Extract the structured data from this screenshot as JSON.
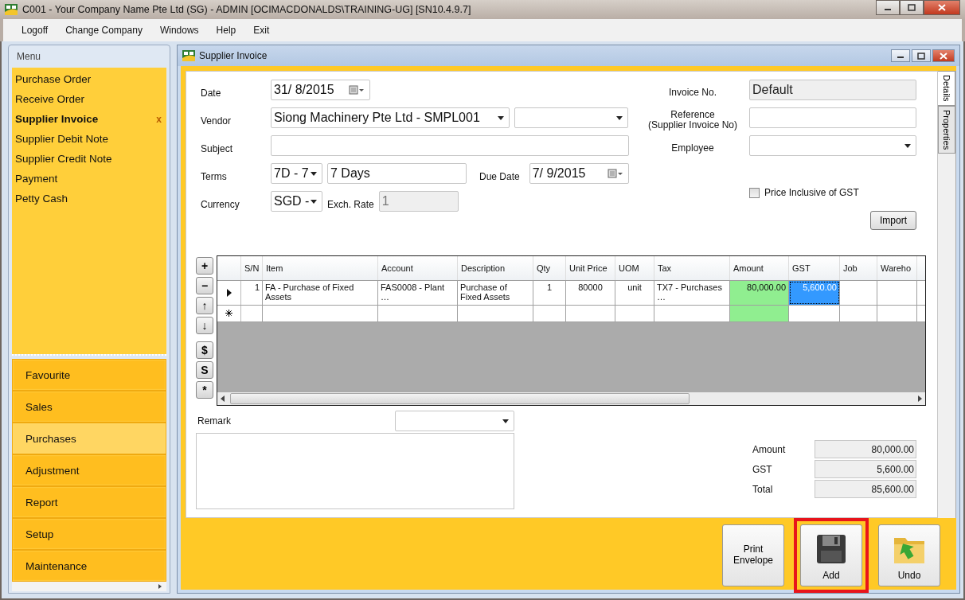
{
  "window": {
    "title": "C001 - Your Company Name Pte Ltd (SG) - ADMIN [OCIMACDONALDS\\TRAINING-UG] [SN10.4.9.7]"
  },
  "menu_bar": [
    "Logoff",
    "Change Company",
    "Windows",
    "Help",
    "Exit"
  ],
  "sidebar": {
    "header": "Menu",
    "items": [
      {
        "label": "Purchase Order",
        "selected": false
      },
      {
        "label": "Receive Order",
        "selected": false
      },
      {
        "label": "Supplier Invoice",
        "selected": true,
        "close": "x"
      },
      {
        "label": "Supplier Debit Note",
        "selected": false
      },
      {
        "label": "Supplier Credit Note",
        "selected": false
      },
      {
        "label": "Payment",
        "selected": false
      },
      {
        "label": "Petty Cash",
        "selected": false
      }
    ],
    "modules": [
      {
        "label": "Favourite",
        "selected": false
      },
      {
        "label": "Sales",
        "selected": false
      },
      {
        "label": "Purchases",
        "selected": true
      },
      {
        "label": "Adjustment",
        "selected": false
      },
      {
        "label": "Report",
        "selected": false
      },
      {
        "label": "Setup",
        "selected": false
      },
      {
        "label": "Maintenance",
        "selected": false
      }
    ]
  },
  "document": {
    "title": "Supplier Invoice",
    "side_tabs": [
      {
        "label": "Details",
        "selected": true
      },
      {
        "label": "Properties",
        "selected": false
      }
    ],
    "date": {
      "label": "Date",
      "value": "31/  8/2015"
    },
    "vendor": {
      "label": "Vendor",
      "value": "Siong Machinery Pte Ltd - SMPL001"
    },
    "subject": {
      "label": "Subject"
    },
    "terms": {
      "label": "Terms",
      "code": "7D - 7",
      "text": "7 Days"
    },
    "due_date": {
      "label": "Due Date",
      "value": "7/  9/2015"
    },
    "currency": {
      "label": "Currency",
      "value": "SGD -"
    },
    "exch_rate": {
      "label": "Exch. Rate",
      "value": "1",
      "disabled": true
    },
    "invoice_no": {
      "label": "Invoice No.",
      "value": "Default",
      "disabled": true
    },
    "reference": {
      "label": "Reference\n(Supplier Invoice No)"
    },
    "employee": {
      "label": "Employee"
    },
    "price_inclusive": {
      "label": "Price Inclusive of GST",
      "checked": false
    },
    "import_button": "Import",
    "grid_tools": [
      "+",
      "−",
      "↑",
      "↓",
      "$",
      "S",
      "*"
    ],
    "table": {
      "columns": [
        {
          "label": "S/N",
          "kind": "input"
        },
        {
          "label": "Item",
          "kind": "input"
        },
        {
          "label": "Account",
          "kind": "input"
        },
        {
          "label": "Description",
          "kind": "input"
        },
        {
          "label": "Qty",
          "kind": "input"
        },
        {
          "label": "Unit Price",
          "kind": "input"
        },
        {
          "label": "UOM",
          "kind": "input"
        },
        {
          "label": "Tax",
          "kind": "input"
        },
        {
          "label": "Amount",
          "kind": "calculated"
        },
        {
          "label": "GST",
          "kind": "input"
        },
        {
          "label": "Job",
          "kind": "input"
        },
        {
          "label": "Wareho",
          "kind": "input"
        }
      ],
      "rows": [
        {
          "kind": "current",
          "cells": [
            {
              "text": "1",
              "selected": false
            },
            {
              "text": "FA - Purchase of Fixed Assets",
              "selected": false
            },
            {
              "text": "FAS0008 - Plant …",
              "selected": false
            },
            {
              "text": "Purchase of Fixed Assets",
              "selected": false
            },
            {
              "text": "1",
              "selected": false
            },
            {
              "text": "80000",
              "selected": false
            },
            {
              "text": "unit",
              "selected": false
            },
            {
              "text": "TX7 - Purchases …",
              "selected": false
            },
            {
              "text": "80,000.00",
              "selected": false
            },
            {
              "text": "5,600.00",
              "selected": true
            }
          ]
        },
        {
          "kind": "new",
          "cells": []
        }
      ]
    },
    "remark": {
      "label": "Remark"
    },
    "totals": [
      {
        "label": "Amount",
        "value": "80,000.00"
      },
      {
        "label": "GST",
        "value": "5,600.00"
      },
      {
        "label": "Total",
        "value": "85,600.00"
      }
    ],
    "actions": [
      {
        "kind": "text",
        "label": "Print Envelope",
        "highlighted": false
      },
      {
        "kind": "save",
        "label": "Add",
        "highlighted": true
      },
      {
        "kind": "undo",
        "label": "Undo",
        "highlighted": false
      }
    ]
  }
}
